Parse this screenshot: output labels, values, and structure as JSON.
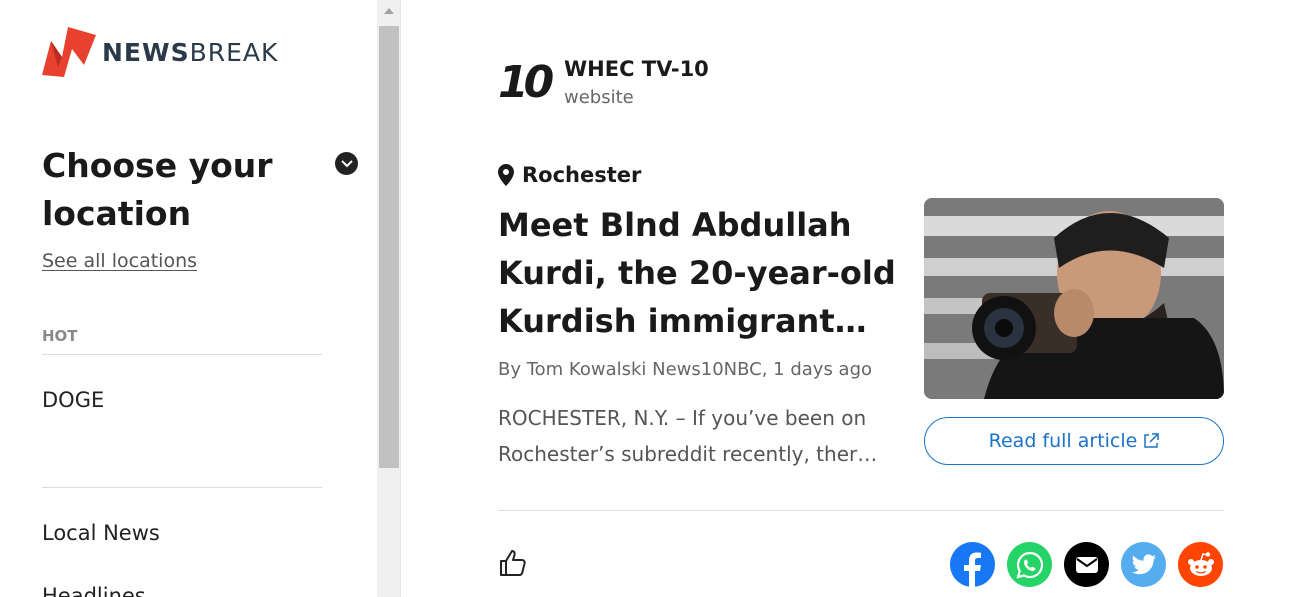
{
  "brand": {
    "name_bold": "NEWS",
    "name_rest": "BREAK"
  },
  "sidebar": {
    "choose_title": "Choose your location",
    "see_all": "See all locations",
    "hot_label": "HOT",
    "hot_items": [
      "DOGE"
    ],
    "nav_items": [
      "Local News",
      "Headlines"
    ]
  },
  "article": {
    "source_logo": "10",
    "source_name": "WHEC TV-10",
    "source_type": "website",
    "location": "Rochester",
    "headline": "Meet Blnd Abdullah Kurdi, the 20-year-old Kurdish immigrant…",
    "byline": "By Tom Kowalski News10NBC, 1 days ago",
    "excerpt": "ROCHESTER, N.Y. – If you’ve been on Rochester’s subreddit recently, ther…",
    "read_label": "Read full article"
  },
  "share": [
    {
      "name": "facebook",
      "color": "#1877f2"
    },
    {
      "name": "whatsapp",
      "color": "#25d366"
    },
    {
      "name": "email",
      "color": "#000000"
    },
    {
      "name": "twitter",
      "color": "#55acee"
    },
    {
      "name": "reddit",
      "color": "#ff4500"
    }
  ],
  "colors": {
    "accent": "#1a73c9",
    "brand_red": "#e8412f"
  }
}
